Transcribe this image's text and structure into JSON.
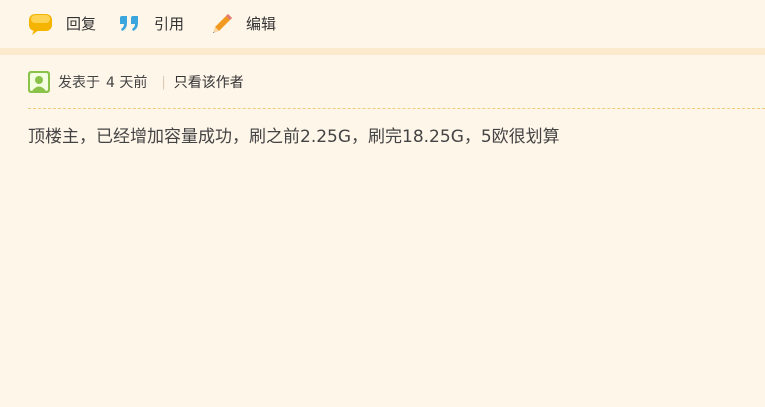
{
  "toolbar": {
    "reply_label": "回复",
    "quote_label": "引用",
    "edit_label": "编辑"
  },
  "post": {
    "posted_prefix": "发表于",
    "posted_time": "4 天前",
    "separator": "|",
    "only_author_label": "只看该作者",
    "content": "顶楼主，已经增加容量成功，刷之前2.25G，刷完18.25G，5欧很划算"
  },
  "colors": {
    "background": "#fff6ea",
    "divider_bar": "#fbeacc",
    "dashed_line": "#f0cc7a",
    "reply_icon": "#f5b400",
    "quote_icon": "#3aa6dd",
    "edit_icon": "#f29a1f",
    "avatar": "#8bc34a"
  },
  "icons": {
    "reply": "speech-bubble-icon",
    "quote": "quote-marks-icon",
    "edit": "pencil-icon",
    "avatar": "user-avatar-icon"
  }
}
